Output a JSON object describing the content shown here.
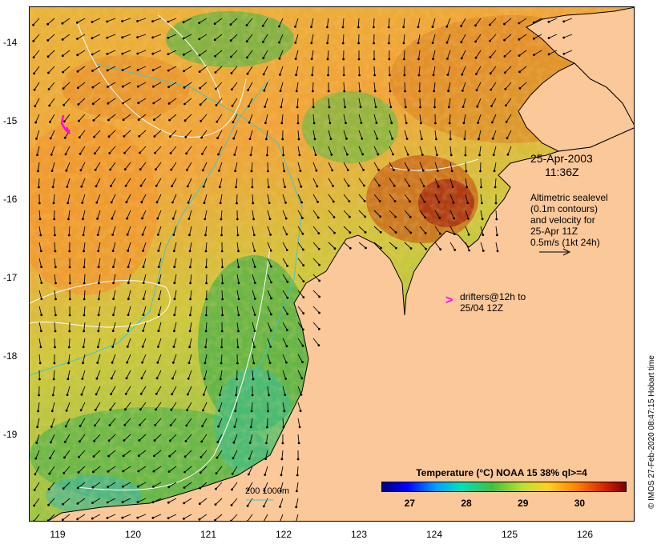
{
  "latitude_labels": [
    "-14",
    "-15",
    "-16",
    "-17",
    "-18",
    "-19"
  ],
  "longitude_labels": [
    "119",
    "120",
    "121",
    "122",
    "123",
    "124",
    "125",
    "126"
  ],
  "annotations": {
    "date": "25-Apr-2003",
    "time": "11:36Z",
    "altimetric_1": "Altimetric sealevel",
    "altimetric_2": "(0.1m contours)",
    "altimetric_3": "and velocity for",
    "altimetric_4": "25-Apr 11Z",
    "velocity_scale": "0.5m/s (1kt 24h)",
    "drifters_1": "drifters@12h to",
    "drifters_2": "25/04 12Z",
    "drifter_marker": ">"
  },
  "contour_label": "200  1000m",
  "credit": "© IMOS 27-Feb-2020 08:47:15 Hobart time",
  "colorbar": {
    "title": "Temperature (°C) NOAA 15 38% ql>=4",
    "ticks": [
      "27",
      "28",
      "29",
      "30"
    ],
    "tick_values": [
      27,
      28,
      29,
      30
    ],
    "range": [
      26.5,
      30.8
    ]
  },
  "colors": {
    "land": "#fbc89a",
    "sst_warm": "#f2a23a",
    "sst_mid": "#d6cf3c",
    "sst_cool": "#4fb84f",
    "isobath": "#43c6c8",
    "contour": "#ffffff",
    "drifter": "#ff00ff"
  }
}
